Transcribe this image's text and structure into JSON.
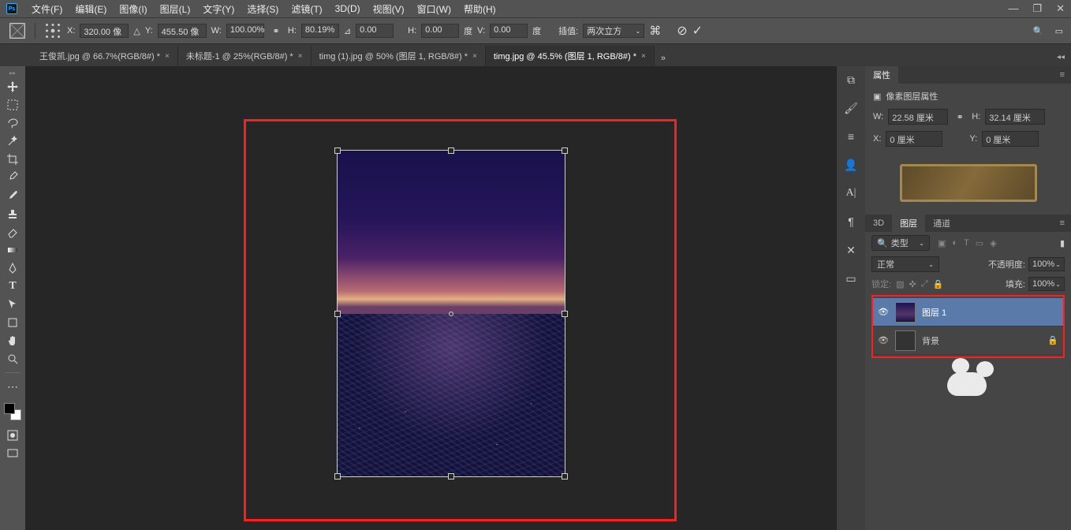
{
  "menu": [
    "文件(F)",
    "编辑(E)",
    "图像(I)",
    "图层(L)",
    "文字(Y)",
    "选择(S)",
    "滤镜(T)",
    "3D(D)",
    "视图(V)",
    "窗口(W)",
    "帮助(H)"
  ],
  "options": {
    "x_label": "X:",
    "x": "320.00 像",
    "y_label": "Y:",
    "y": "455.50 像",
    "w_label": "W:",
    "w": "100.00%",
    "h_label": "H:",
    "h": "80.19%",
    "angle": "0.00",
    "h2_label": "H:",
    "h2": "0.00",
    "h2_unit": "度",
    "v_label": "V:",
    "v": "0.00",
    "v_unit": "度",
    "interp_label": "插值:",
    "interp": "两次立方"
  },
  "tabs": [
    {
      "label": "王俊凯.jpg @ 66.7%(RGB/8#) *",
      "active": false
    },
    {
      "label": "未标题-1 @ 25%(RGB/8#) *",
      "active": false
    },
    {
      "label": "timg (1).jpg @ 50% (图层 1, RGB/8#) *",
      "active": false
    },
    {
      "label": "timg.jpg @ 45.5% (图层 1, RGB/8#) *",
      "active": true
    }
  ],
  "properties": {
    "tab": "属性",
    "header": "像素图层属性",
    "w_label": "W:",
    "w": "22.58 厘米",
    "h_label": "H:",
    "h": "32.14 厘米",
    "x_label": "X:",
    "x": "0 厘米",
    "y_label": "Y:",
    "y": "0 厘米"
  },
  "layers_panel": {
    "tabs": [
      "3D",
      "图层",
      "通道"
    ],
    "active_tab": "图层",
    "search_placeholder": "类型",
    "blend": "正常",
    "opacity_label": "不透明度:",
    "opacity": "100%",
    "lock_label": "锁定:",
    "fill_label": "填充:",
    "fill": "100%",
    "layers": [
      {
        "name": "图层 1",
        "selected": true,
        "locked": false
      },
      {
        "name": "背景",
        "selected": false,
        "locked": true
      }
    ]
  }
}
